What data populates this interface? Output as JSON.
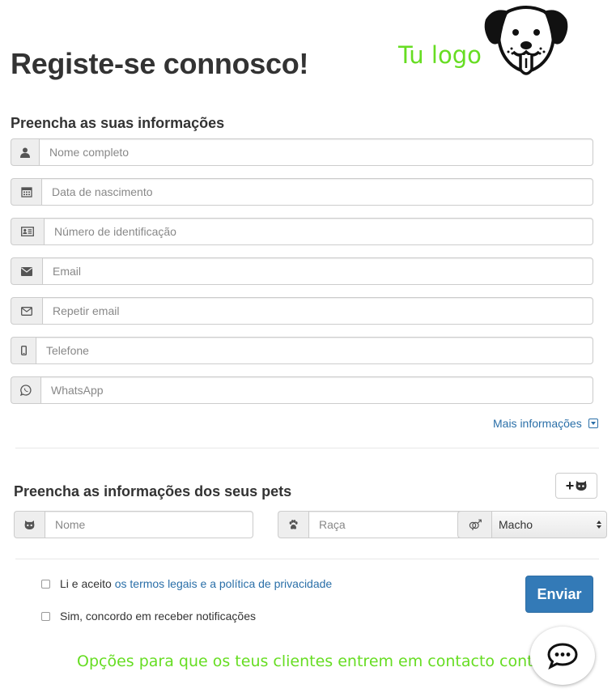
{
  "header": {
    "title": "Registe-se connosco!",
    "logo_text": "Tu logo"
  },
  "owner_section": {
    "title": "Preencha as suas informações",
    "fields": [
      {
        "icon": "user-icon",
        "placeholder": "Nome completo"
      },
      {
        "icon": "calendar-icon",
        "placeholder": "Data de nascimento"
      },
      {
        "icon": "id-card-icon",
        "placeholder": "Número de identificação"
      },
      {
        "icon": "envelope-icon",
        "placeholder": "Email"
      },
      {
        "icon": "envelope-outline-icon",
        "placeholder": "Repetir email"
      },
      {
        "icon": "mobile-phone-icon",
        "placeholder": "Telefone"
      },
      {
        "icon": "whatsapp-icon",
        "placeholder": "WhatsApp"
      }
    ],
    "more_info": "Mais informações"
  },
  "pet_section": {
    "title": "Preencha as informações dos seus pets",
    "add_button_symbol": "+",
    "name_placeholder": "Nome",
    "breed_placeholder": "Raça",
    "sex_selected": "Macho"
  },
  "consent": {
    "terms_prefix": "Li e aceito",
    "terms_link": "os termos legais e a política de privacidade",
    "notifications": "Sim, concordo em receber notificações"
  },
  "submit_label": "Enviar",
  "contact_text": "Opções para que os teus clientes entrem em contacto contigo",
  "colors": {
    "accent": "#337ab7",
    "link": "#2a6fa8",
    "promo_green": "#66dd22"
  }
}
